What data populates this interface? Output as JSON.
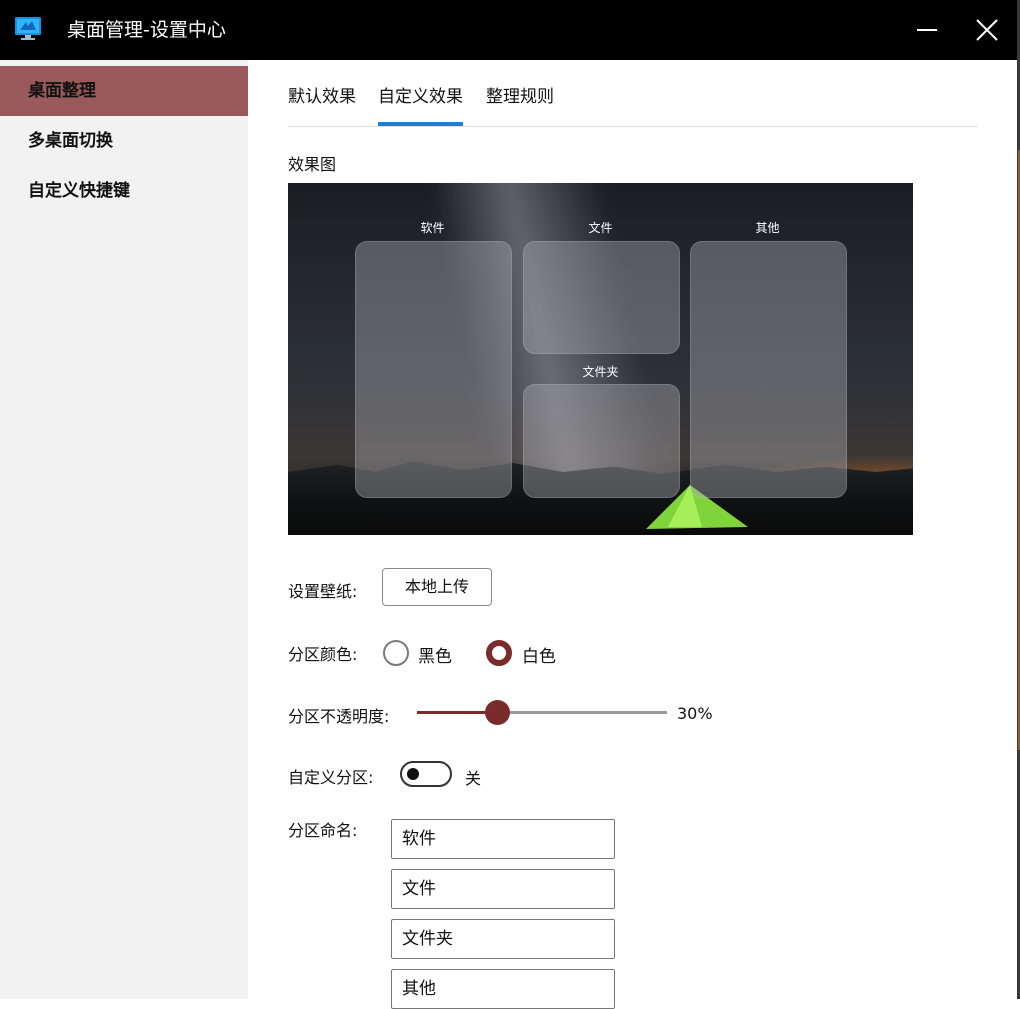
{
  "window": {
    "title": "桌面管理-设置中心"
  },
  "sidebar": {
    "items": [
      {
        "label": "桌面整理",
        "active": true
      },
      {
        "label": "多桌面切换",
        "active": false
      },
      {
        "label": "自定义快捷键",
        "active": false
      }
    ]
  },
  "tabs": [
    {
      "label": "默认效果",
      "active": false
    },
    {
      "label": "自定义效果",
      "active": true
    },
    {
      "label": "整理规则",
      "active": false
    }
  ],
  "preview": {
    "label": "效果图",
    "zones": [
      "软件",
      "文件",
      "文件夹",
      "其他"
    ]
  },
  "wallpaper": {
    "label": "设置壁纸:",
    "button": "本地上传"
  },
  "zone_color": {
    "label": "分区颜色:",
    "options": [
      "黑色",
      "白色"
    ],
    "selected": "白色",
    "accent": "#7a2c2d"
  },
  "zone_opacity": {
    "label": "分区不透明度:",
    "value": 30,
    "display": "30%"
  },
  "custom_zone": {
    "label": "自定义分区:",
    "state": "关",
    "on": false
  },
  "zone_names": {
    "label": "分区命名:",
    "values": [
      "软件",
      "文件",
      "文件夹",
      "其他"
    ]
  },
  "colors": {
    "sidebar_active": "#9a5a5c",
    "tab_indicator": "#1e7fd8",
    "titlebar": "#000000"
  }
}
